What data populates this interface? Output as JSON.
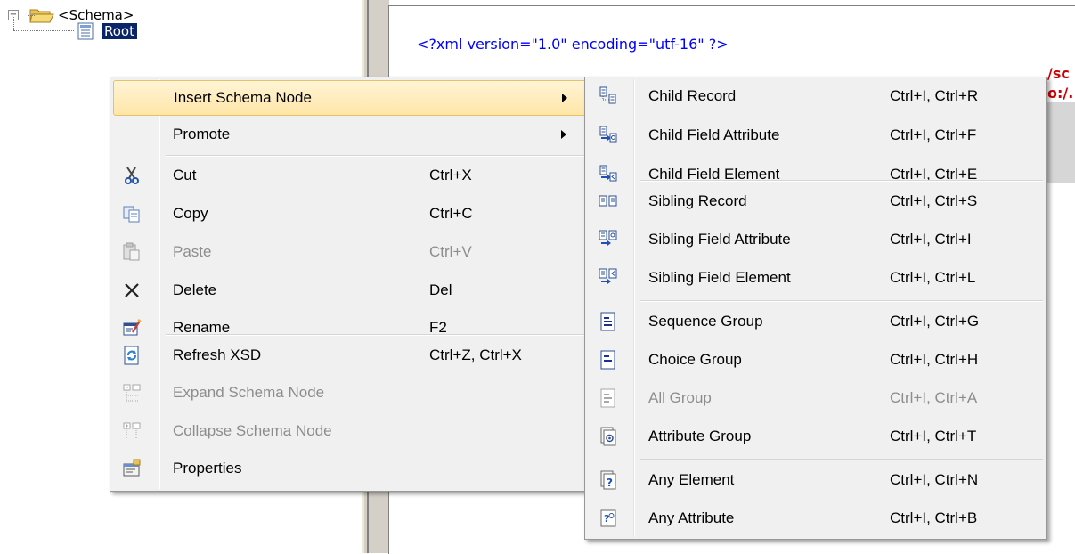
{
  "tree": {
    "schema_label": "<Schema>",
    "root_label": "Root"
  },
  "editor": {
    "xml_declaration": "<?xml version=\"1.0\" encoding=\"utf-16\" ?>",
    "overflow_1": "/sc",
    "overflow_2": "o:/."
  },
  "context_menu": {
    "items": [
      {
        "label": "Insert Schema Node",
        "shortcut": "",
        "icon": "insert-icon",
        "enabled": true,
        "highlighted": true,
        "submenu": true
      },
      {
        "label": "Promote",
        "shortcut": "",
        "icon": "",
        "enabled": true,
        "submenu": true
      },
      {
        "label": "Cut",
        "shortcut": "Ctrl+X",
        "icon": "scissors-icon",
        "enabled": true
      },
      {
        "label": "Copy",
        "shortcut": "Ctrl+C",
        "icon": "copy-icon",
        "enabled": true
      },
      {
        "label": "Paste",
        "shortcut": "Ctrl+V",
        "icon": "paste-icon",
        "enabled": false
      },
      {
        "label": "Delete",
        "shortcut": "Del",
        "icon": "delete-x-icon",
        "enabled": true
      },
      {
        "label": "Rename",
        "shortcut": "F2",
        "icon": "rename-icon",
        "enabled": true
      },
      {
        "label": "Refresh XSD",
        "shortcut": "Ctrl+Z, Ctrl+X",
        "icon": "refresh-icon",
        "enabled": true
      },
      {
        "label": "Expand Schema Node",
        "shortcut": "",
        "icon": "expand-node-icon",
        "enabled": false
      },
      {
        "label": "Collapse Schema Node",
        "shortcut": "",
        "icon": "collapse-node-icon",
        "enabled": false
      },
      {
        "label": "Properties",
        "shortcut": "",
        "icon": "properties-icon",
        "enabled": true
      }
    ]
  },
  "submenu": {
    "items": [
      {
        "label": "Child Record",
        "shortcut": "Ctrl+I, Ctrl+R",
        "icon": "child-record-icon",
        "enabled": true
      },
      {
        "label": "Child Field Attribute",
        "shortcut": "Ctrl+I, Ctrl+F",
        "icon": "child-field-attribute-icon",
        "enabled": true
      },
      {
        "label": "Child Field Element",
        "shortcut": "Ctrl+I, Ctrl+E",
        "icon": "child-field-element-icon",
        "enabled": true
      },
      {
        "label": "Sibling Record",
        "shortcut": "Ctrl+I, Ctrl+S",
        "icon": "sibling-record-icon",
        "enabled": true
      },
      {
        "label": "Sibling Field Attribute",
        "shortcut": "Ctrl+I, Ctrl+I",
        "icon": "sibling-field-attribute-icon",
        "enabled": true
      },
      {
        "label": "Sibling Field Element",
        "shortcut": "Ctrl+I, Ctrl+L",
        "icon": "sibling-field-element-icon",
        "enabled": true
      },
      {
        "label": "Sequence Group",
        "shortcut": "Ctrl+I, Ctrl+G",
        "icon": "sequence-group-icon",
        "enabled": true
      },
      {
        "label": "Choice Group",
        "shortcut": "Ctrl+I, Ctrl+H",
        "icon": "choice-group-icon",
        "enabled": true
      },
      {
        "label": "All Group",
        "shortcut": "Ctrl+I, Ctrl+A",
        "icon": "all-group-icon",
        "enabled": false
      },
      {
        "label": "Attribute Group",
        "shortcut": "Ctrl+I, Ctrl+T",
        "icon": "attribute-group-icon",
        "enabled": true
      },
      {
        "label": "Any Element",
        "shortcut": "Ctrl+I, Ctrl+N",
        "icon": "any-element-icon",
        "enabled": true
      },
      {
        "label": "Any Attribute",
        "shortcut": "Ctrl+I, Ctrl+B",
        "icon": "any-attribute-icon",
        "enabled": true
      }
    ]
  },
  "colors": {
    "highlight": "#ffe6a8",
    "selection": "#0a246a",
    "xml_blue": "#0000ff",
    "xml_red": "#cc0000",
    "disabled_text": "#8d8d8d"
  }
}
